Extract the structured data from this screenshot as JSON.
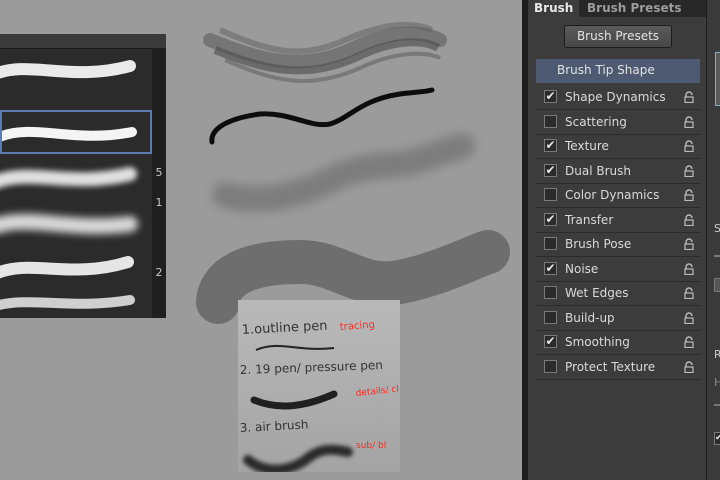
{
  "panel": {
    "tabs": [
      "Brush",
      "Brush Presets"
    ],
    "presets_button": "Brush Presets",
    "tip_shape": "Brush Tip Shape",
    "options": [
      {
        "label": "Shape Dynamics",
        "checked": true
      },
      {
        "label": "Scattering",
        "checked": false
      },
      {
        "label": "Texture",
        "checked": true
      },
      {
        "label": "Dual Brush",
        "checked": true
      },
      {
        "label": "Color Dynamics",
        "checked": false
      },
      {
        "label": "Transfer",
        "checked": true
      },
      {
        "label": "Brush Pose",
        "checked": false
      },
      {
        "label": "Noise",
        "checked": true
      },
      {
        "label": "Wet Edges",
        "checked": false
      },
      {
        "label": "Build-up",
        "checked": false
      },
      {
        "label": "Smoothing",
        "checked": true
      },
      {
        "label": "Protect Texture",
        "checked": false
      }
    ],
    "cut_labels": [
      "S",
      "R",
      "H"
    ]
  },
  "brush_list": {
    "sizes": [
      "5",
      "1",
      "2"
    ]
  },
  "notes": {
    "line1": "1.outline pen",
    "line1_red": "tracing",
    "line2": "2. 19 pen/ pressure pen",
    "line2_red": "details/ cl",
    "line3": "3. air brush",
    "line3_red": "sub/ bl"
  },
  "colors": {
    "panel_bg": "#3c3c3c",
    "highlight": "#4d5a72",
    "canvas": "#9b9b9b",
    "annotation_red": "#ff2a1a"
  }
}
